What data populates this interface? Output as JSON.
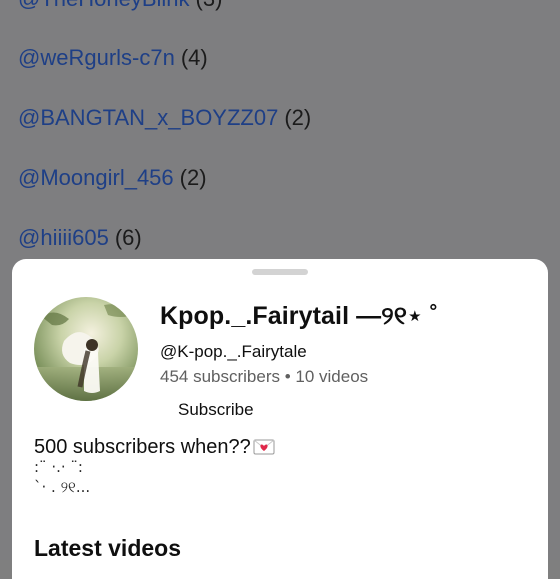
{
  "background_list": [
    {
      "handle": "@TheHoneyBlink",
      "count": "(3)"
    },
    {
      "handle": "@weRgurls-c7n",
      "count": "(4)"
    },
    {
      "handle": "@BANGTAN_x_BOYZZ07",
      "count": "(2)"
    },
    {
      "handle": "@Moongirl_456",
      "count": "(2)"
    },
    {
      "handle": "@hiiii605",
      "count": "(6)"
    }
  ],
  "sheet": {
    "channel_title": "Kpop._.Fairytail —୨୧⋆ ˚",
    "channel_handle": "@K-pop._.Fairytale",
    "stats": "454 subscribers • 10 videos",
    "subscribe_label": "Subscribe",
    "description_line1": "500 subscribers when??",
    "description_line2": ":¨ ·.· ¨:",
    "description_line3": " `· . ୨୧...",
    "latest_videos_heading": "Latest videos"
  },
  "icons": {
    "avatar": "avatar-photo",
    "envelope": "love-letter-icon"
  },
  "colors": {
    "link": "#1e3f86",
    "sheet_bg": "#ffffff",
    "overlay": "#7e7e80"
  }
}
